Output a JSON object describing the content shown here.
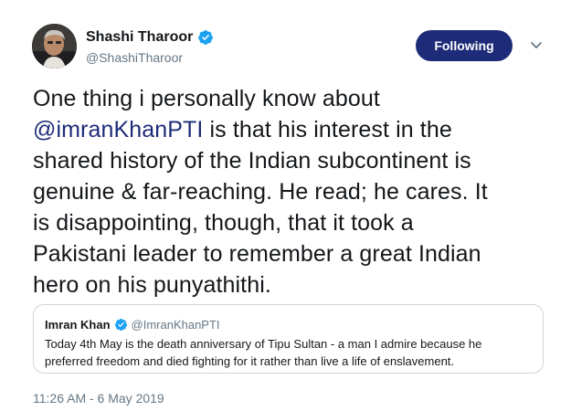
{
  "author": {
    "display_name": "Shashi Tharoor",
    "handle": "@ShashiTharoor",
    "verified": true,
    "avatar_icon": "profile-photo-avatar"
  },
  "follow_button": {
    "label": "Following"
  },
  "more_menu": {
    "icon": "chevron-down-icon"
  },
  "tweet": {
    "line1": "One thing i personally know about",
    "mention": "@imranKhanPTI",
    "line2_rest": " is that his interest in the",
    "line3": "shared history of the Indian subcontinent is",
    "line4": "genuine & far-reaching. He read; he cares. It",
    "line5": "is disappointing, though, that it took a",
    "line6": "Pakistani leader to remember a great Indian",
    "line7": "hero on his punyathithi."
  },
  "quoted_tweet": {
    "display_name": "Imran Khan",
    "handle": "@ImranKhanPTI",
    "verified": true,
    "line1": "Today 4th May is the death anniversary of Tipu Sultan - a man I admire because he",
    "line2": "preferred freedom and died fighting for it rather than live a life of enslavement."
  },
  "timestamp": "11:26 AM - 6 May 2019",
  "colors": {
    "accent": "#1e2b78",
    "verified_badge": "#1da1f2",
    "secondary_text": "#657786",
    "border": "#ccd6dd"
  }
}
